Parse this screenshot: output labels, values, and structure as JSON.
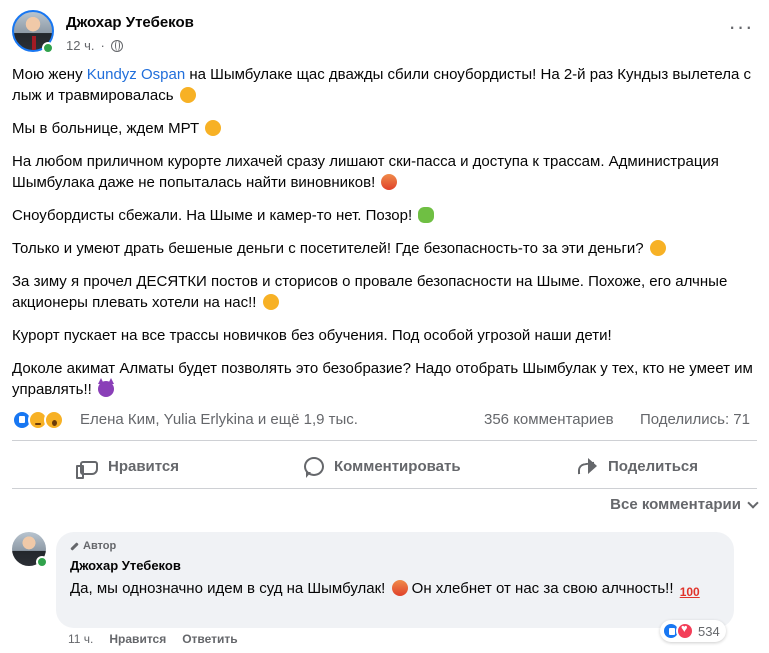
{
  "post": {
    "author": "Джохар Утебеков",
    "time": "12 ч.",
    "paragraphs": [
      {
        "before": "Мою жену ",
        "mention": "Kundyz Ospan",
        "after": " на Шымбулаке щас дважды сбили сноубордисты! На 2-й раз Кундыз вылетела с лыж и травмировалась",
        "emoji": "sad-face"
      },
      {
        "text": "Мы в больнице, ждем МРТ",
        "emoji": "sad-face"
      },
      {
        "text": "На любом приличном курорте лихачей сразу лишают ски-пасса и доступа к трассам. Администрация Шымбулака даже не попыталась найти виновников!",
        "emoji": "angry-face"
      },
      {
        "text": "Сноубордисты сбежали. На Шыме и камер-то нет. Позор!",
        "emoji": "nauseated-face"
      },
      {
        "text": "Только и умеют драть бешеные деньги с посетителей! Где безопасность-то за эти деньги?",
        "emoji": "sad-face"
      },
      {
        "text": "За зиму я прочел ДЕСЯТКИ постов и сторисов о провале безопасности на Шыме. Похоже, его алчные акционеры плевать хотели на нас!!",
        "emoji": "sad-face"
      },
      {
        "text": "Курорт пускает на все трассы новичков без обучения. Под особой угрозой наши дети!"
      },
      {
        "text": "Доколе акимат Алматы будет позволять это безобразие? Надо отобрать Шымбулак у тех, кто не умеет им управлять!!",
        "emoji": "devil-face"
      }
    ]
  },
  "stats": {
    "reactors": "Елена Ким, Yulia Erlykina и ещё 1,9 тыс.",
    "comments": "356 комментариев",
    "shares": "Поделились: 71"
  },
  "actions": {
    "like": "Нравится",
    "comment": "Комментировать",
    "share": "Поделиться"
  },
  "sort": {
    "label": "Все комментарии"
  },
  "comment": {
    "badge": "Автор",
    "author": "Джохар Утебеков",
    "text_part1": "Да, мы однозначно идем в суд на Шымбулак!",
    "text_part2": " Он хлебнет от нас за свою алчность!!",
    "emoji1": "angry-face",
    "emoji2": "hundred-points",
    "time": "11 ч.",
    "like": "Нравится",
    "reply": "Ответить",
    "reaction_count": "534"
  },
  "colors": {
    "accent": "#1877f2",
    "link": "#216fdb",
    "secondary_text": "#65676b",
    "online": "#31a24c",
    "comment_bg": "#f0f2f5"
  }
}
